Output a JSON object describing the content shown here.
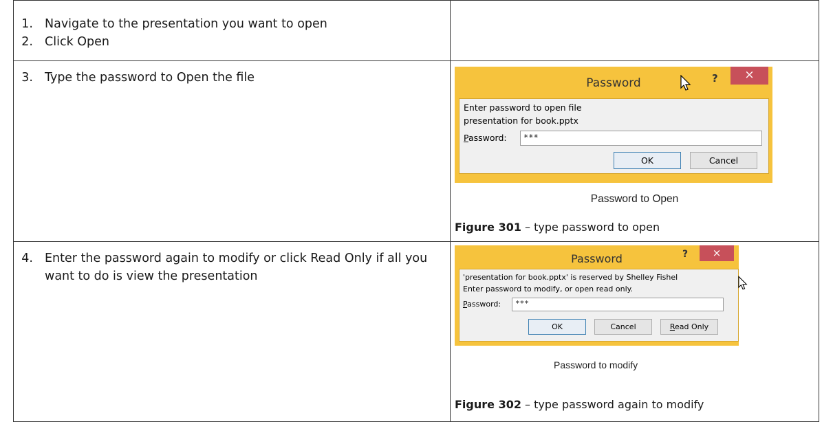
{
  "steps": [
    {
      "num": "1.",
      "text": "Navigate to the presentation you want to open"
    },
    {
      "num": "2.",
      "text": "Click Open"
    },
    {
      "num": "3.",
      "text": "Type the password to Open the file"
    },
    {
      "num": "4.",
      "text": "Enter the password again to modify or click Read Only if all you want to do is view the presentation"
    }
  ],
  "dialog_open": {
    "title": "Password",
    "help": "?",
    "close": "×",
    "line1": "Enter password to open file",
    "line2": "presentation for book.pptx",
    "password_label": "Password:",
    "password_value": "***",
    "ok": "OK",
    "cancel": "Cancel",
    "caption": "Password to Open"
  },
  "figure301": {
    "label": "Figure 301",
    "text": " – type password to open"
  },
  "dialog_modify": {
    "title": "Password",
    "help": "?",
    "close": "×",
    "line1": "'presentation for book.pptx' is reserved by Shelley Fishel",
    "line2": "Enter password to modify, or open read only.",
    "password_label": "Password:",
    "password_value": "***",
    "ok": "OK",
    "cancel": "Cancel",
    "read_only": "Read Only",
    "caption": "Password to modify"
  },
  "figure302": {
    "label": "Figure 302",
    "text": " – type password again to modify"
  },
  "colors": {
    "dialog_frame": "#f6c33d",
    "close_button": "#c7505a",
    "dialog_body": "#f0f0f0"
  }
}
